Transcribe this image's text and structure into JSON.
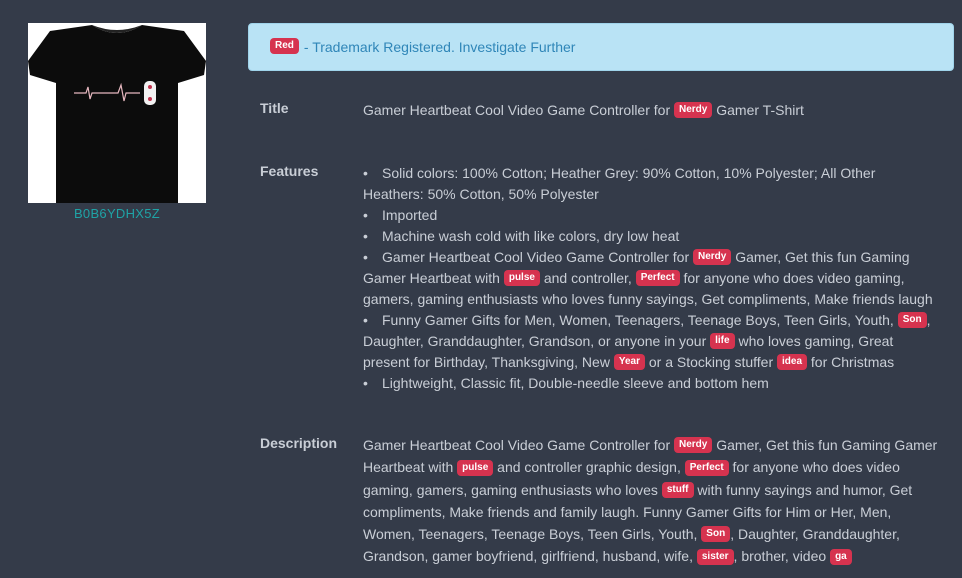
{
  "product": {
    "asin": "B0B6YDHX5Z",
    "image_icon": "black-tshirt-heartbeat-controller-image"
  },
  "alert": {
    "badge": "Red",
    "text": " - Trademark Registered. Investigate Further",
    "colors": {
      "background": "#b9e3f5",
      "text": "#2f86b8",
      "badge": "#d6334f"
    }
  },
  "labels": {
    "title": "Title",
    "features": "Features",
    "description": "Description"
  },
  "title": {
    "parts": [
      {
        "t": "Gamer Heartbeat Cool Video Game Controller for "
      },
      {
        "b": "Nerdy"
      },
      {
        "t": " Gamer T-Shirt"
      }
    ]
  },
  "features": [
    {
      "parts": [
        {
          "t": "Solid colors: 100% Cotton; Heather Grey: 90% Cotton, 10% Polyester; All Other Heathers: 50% Cotton, 50% Polyester"
        }
      ]
    },
    {
      "parts": [
        {
          "t": "Imported"
        }
      ]
    },
    {
      "parts": [
        {
          "t": "Machine wash cold with like colors, dry low heat"
        }
      ]
    },
    {
      "parts": [
        {
          "t": "Gamer Heartbeat Cool Video Game Controller for "
        },
        {
          "b": "Nerdy"
        },
        {
          "t": " Gamer, Get this fun Gaming Gamer Heartbeat with "
        },
        {
          "b": "pulse"
        },
        {
          "t": " and controller, "
        },
        {
          "b": "Perfect"
        },
        {
          "t": " for anyone who does video gaming, gamers, gaming enthusiasts who loves funny sayings, Get compliments, Make friends laugh"
        }
      ]
    },
    {
      "parts": [
        {
          "t": "Funny Gamer Gifts for Men, Women, Teenagers, Teenage Boys, Teen Girls, Youth, "
        },
        {
          "b": "Son"
        },
        {
          "t": ", Daughter, Granddaughter, Grandson, or anyone in your "
        },
        {
          "b": "life"
        },
        {
          "t": " who loves gaming, Great present for Birthday, Thanksgiving, New "
        },
        {
          "b": "Year"
        },
        {
          "t": " or a Stocking stuffer "
        },
        {
          "b": "idea"
        },
        {
          "t": " for Christmas"
        }
      ]
    },
    {
      "parts": [
        {
          "t": "Lightweight, Classic fit, Double-needle sleeve and bottom hem"
        }
      ]
    }
  ],
  "description": {
    "parts": [
      {
        "t": "Gamer Heartbeat Cool Video Game Controller for "
      },
      {
        "b": "Nerdy"
      },
      {
        "t": " Gamer, Get this fun Gaming Gamer Heartbeat with "
      },
      {
        "b": "pulse"
      },
      {
        "t": " and controller graphic design, "
      },
      {
        "b": "Perfect"
      },
      {
        "t": " for anyone who does video gaming, gamers, gaming enthusiasts who loves "
      },
      {
        "b": "stuff"
      },
      {
        "t": " with funny sayings and humor, Get compliments, Make friends and family laugh. Funny Gamer Gifts for Him or Her, Men, Women, Teenagers, Teenage Boys, Teen Girls, Youth, "
      },
      {
        "b": "Son"
      },
      {
        "t": ", Daughter, Granddaughter, Grandson, gamer boyfriend, girlfriend, husband, wife, "
      },
      {
        "b": "sister"
      },
      {
        "t": ", brother, video "
      },
      {
        "b": "ga"
      }
    ]
  }
}
